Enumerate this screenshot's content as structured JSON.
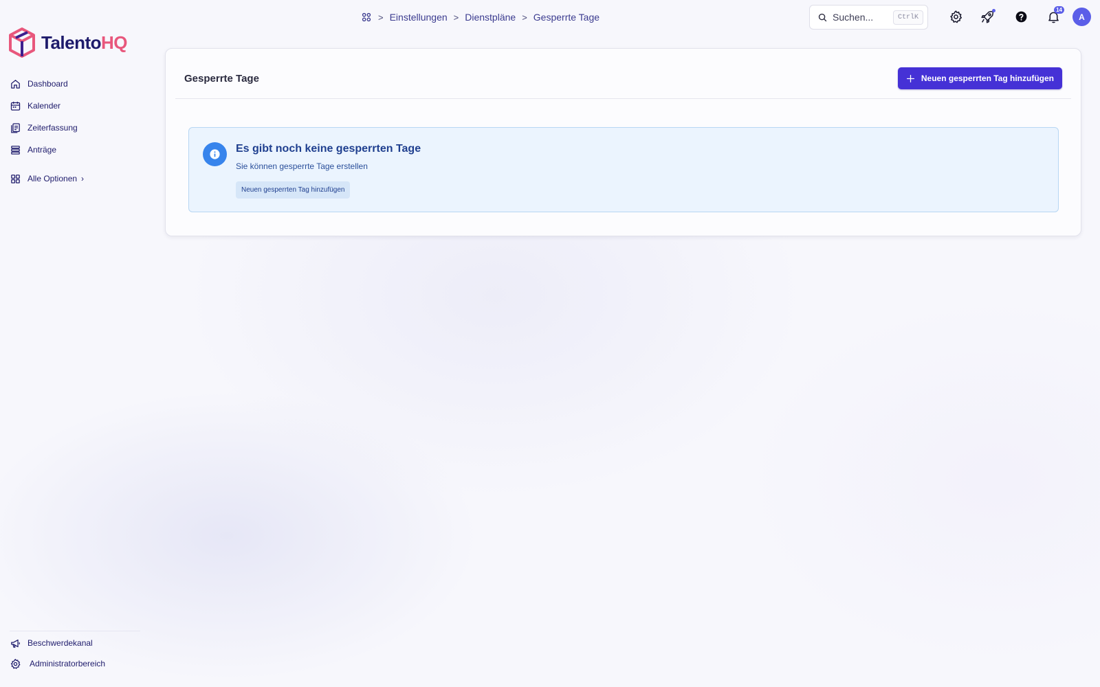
{
  "app": {
    "brand_part1": "Talento",
    "brand_part2": "HQ",
    "brand_color": "#1e1b6b",
    "brand_accent": "#e8577c"
  },
  "sidebar": {
    "items": [
      {
        "label": "Dashboard",
        "icon": "home-icon"
      },
      {
        "label": "Kalender",
        "icon": "calendar-icon"
      },
      {
        "label": "Zeiterfassung",
        "icon": "clipboard-icon"
      },
      {
        "label": "Anträge",
        "icon": "stack-icon"
      },
      {
        "label": "Alle Optionen",
        "icon": "grid-icon"
      }
    ],
    "bottom_items": [
      {
        "label": "Beschwerdekanal",
        "icon": "megaphone-icon"
      },
      {
        "label": "Administratorbereich",
        "icon": "gear-icon"
      }
    ]
  },
  "header": {
    "breadcrumb": [
      "Einstellungen",
      "Dienstpläne",
      "Gesperrte Tage"
    ],
    "search": {
      "placeholder": "Suchen...",
      "shortcut": "CtrlK"
    },
    "notifications_count": "14",
    "avatar_initial": "A"
  },
  "main": {
    "title": "Gesperrte Tage",
    "add_button_label": "Neuen gesperrten Tag hinzufügen",
    "accent_color": "#4531d6",
    "empty_state": {
      "title": "Es gibt noch keine gesperrten Tage",
      "text": "Sie können gesperrte Tage erstellen",
      "button_label": "Neuen gesperrten Tag hinzufügen",
      "icon": "info-icon",
      "color": "#3784ec"
    }
  }
}
